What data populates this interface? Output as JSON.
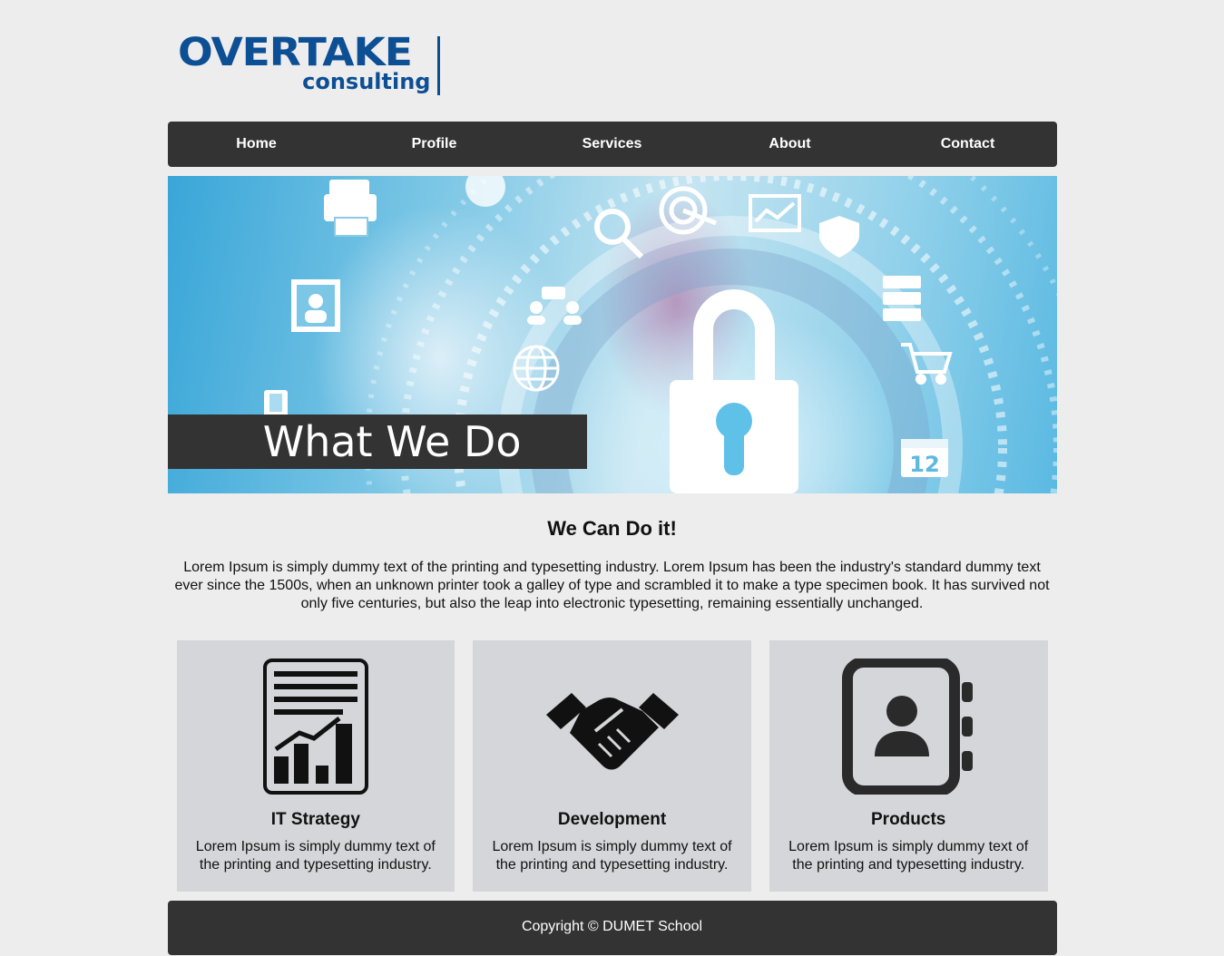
{
  "logo": {
    "main": "OVERTAKE",
    "sub": "consulting",
    "color": "#0d4f94"
  },
  "nav": [
    "Home",
    "Profile",
    "Services",
    "About",
    "Contact"
  ],
  "hero": {
    "title": "What We Do"
  },
  "section": {
    "heading": "We Can Do it!",
    "intro": "Lorem Ipsum is simply dummy text of the printing and typesetting industry. Lorem Ipsum has been the industry's standard dummy text ever since the 1500s, when an unknown printer took a galley of type and scrambled it to make a type specimen book. It has survived not only five centuries, but also the leap into electronic typesetting, remaining essentially unchanged."
  },
  "cards": [
    {
      "icon": "report-chart-icon",
      "title": "IT Strategy",
      "text": "Lorem Ipsum is simply dummy text of the printing and typesetting industry."
    },
    {
      "icon": "handshake-icon",
      "title": "Development",
      "text": "Lorem Ipsum is simply dummy text of the printing and typesetting industry."
    },
    {
      "icon": "contact-book-icon",
      "title": "Products",
      "text": "Lorem Ipsum is simply dummy text of the printing and typesetting industry."
    }
  ],
  "footer": {
    "copyright": "Copyright © DUMET School"
  },
  "colors": {
    "nav_bg": "#333333",
    "page_bg": "#ededed",
    "card_bg": "#d5d6da",
    "brand": "#0d4f94"
  }
}
